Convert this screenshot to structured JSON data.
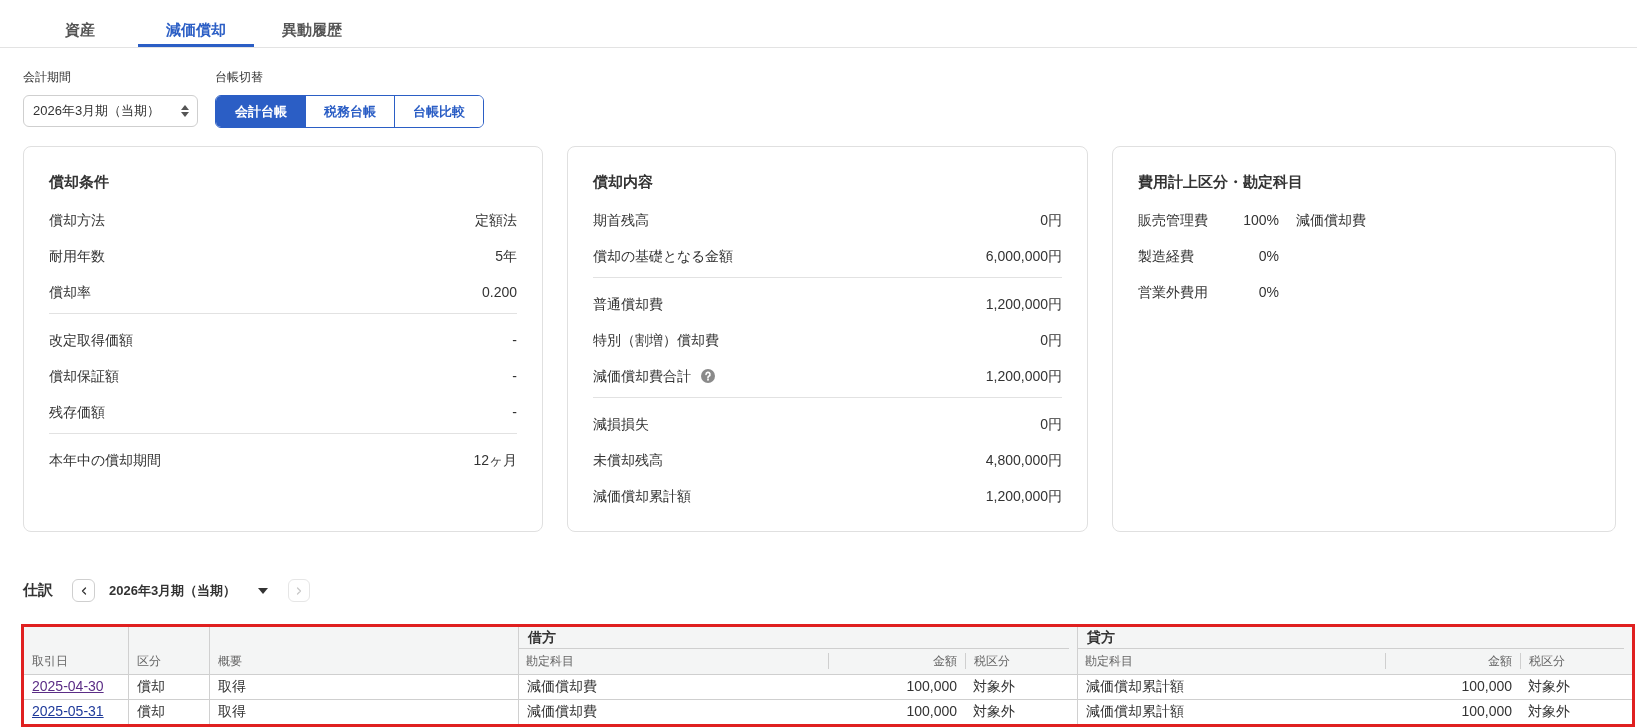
{
  "tabs": [
    {
      "label": "資産",
      "selected": false
    },
    {
      "label": "減価償却",
      "selected": true
    },
    {
      "label": "異動履歴",
      "selected": false
    }
  ],
  "filters": {
    "period": {
      "label": "会計期間",
      "value": "2026年3月期（当期）"
    },
    "ledger": {
      "label": "台帳切替",
      "options": [
        {
          "label": "会計台帳",
          "selected": true
        },
        {
          "label": "税務台帳",
          "selected": false
        },
        {
          "label": "台帳比較",
          "selected": false
        }
      ]
    }
  },
  "cards": [
    {
      "kind": "summary",
      "title": "償却条件",
      "sections": [
        {
          "rows": [
            {
              "label": "償却方法",
              "value": "定額法"
            },
            {
              "label": "耐用年数",
              "value": "5年"
            },
            {
              "label": "償却率",
              "value": "0.200"
            }
          ]
        },
        {
          "rows": [
            {
              "label": "改定取得価額",
              "value": "-"
            },
            {
              "label": "償却保証額",
              "value": "-"
            },
            {
              "label": "残存価額",
              "value": "-"
            }
          ]
        },
        {
          "rows": [
            {
              "label": "本年中の償却期間",
              "value": "12ヶ月"
            }
          ]
        }
      ]
    },
    {
      "kind": "summary",
      "title": "償却内容",
      "sections": [
        {
          "rows": [
            {
              "label": "期首残高",
              "value": "0円"
            },
            {
              "label": "償却の基礎となる金額",
              "value": "6,000,000円"
            }
          ]
        },
        {
          "rows": [
            {
              "label": "普通償却費",
              "value": "1,200,000円"
            },
            {
              "label": "特別（割増）償却費",
              "value": "0円"
            },
            {
              "label": "減価償却費合計",
              "value": "1,200,000円",
              "help": true
            }
          ]
        },
        {
          "rows": [
            {
              "label": "減損損失",
              "value": "0円"
            },
            {
              "label": "未償却残高",
              "value": "4,800,000円"
            },
            {
              "label": "減価償却累計額",
              "value": "1,200,000円"
            }
          ]
        }
      ]
    },
    {
      "kind": "allocation",
      "title": "費用計上区分・勘定科目",
      "rows": [
        {
          "category": "販売管理費",
          "share": "100%",
          "account": "減価償却費"
        },
        {
          "category": "製造経費",
          "share": "0%"
        },
        {
          "category": "営業外費用",
          "share": "0%"
        }
      ]
    }
  ],
  "journal": {
    "title": "仕訳",
    "period": "2026年3月期（当期）",
    "previous": {
      "disabled": false
    },
    "next": {
      "disabled": true
    },
    "table": {
      "columns": [
        "取引日",
        "区分",
        "概要"
      ],
      "debit": {
        "label": "借方",
        "columns": [
          "勘定科目",
          "金額",
          "税区分"
        ]
      },
      "credit": {
        "label": "貸方",
        "columns": [
          "勘定科目",
          "金額",
          "税区分"
        ]
      },
      "rows": [
        {
          "date": "2025-04-30",
          "visited": true,
          "type": "償却",
          "summary": "取得",
          "debit": {
            "account": "減価償却費",
            "amount": "100,000",
            "tax": "対象外"
          },
          "credit": {
            "account": "減価償却累計額",
            "amount": "100,000",
            "tax": "対象外"
          }
        },
        {
          "date": "2025-05-31",
          "visited": false,
          "type": "償却",
          "summary": "取得",
          "debit": {
            "account": "減価償却費",
            "amount": "100,000",
            "tax": "対象外"
          },
          "credit": {
            "account": "減価償却累計額",
            "amount": "100,000",
            "tax": "対象外"
          }
        }
      ]
    }
  }
}
